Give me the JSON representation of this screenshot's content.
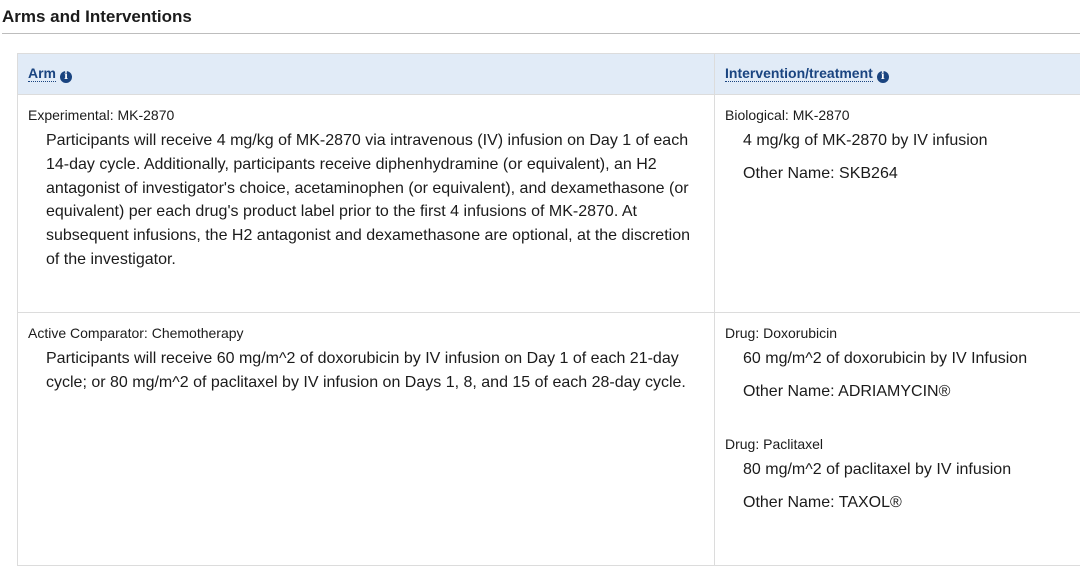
{
  "section": {
    "title": "Arms and Interventions"
  },
  "table": {
    "headers": {
      "arm": "Arm",
      "intervention": "Intervention/treatment"
    },
    "rows": [
      {
        "arm_label": "Experimental: MK-2870",
        "arm_description": "Participants will receive 4 mg/kg of MK-2870 via intravenous (IV) infusion on Day 1 of each 14-day cycle. Additionally, participants receive diphenhydramine (or equivalent), an H2 antagonist of investigator's choice, acetaminophen (or equivalent), and dexamethasone (or equivalent) per each drug's product label prior to the first 4 infusions of MK-2870. At subsequent infusions, the H2 antagonist and dexamethasone are optional, at the discretion of the investigator.",
        "interventions": [
          {
            "label": "Biological: MK-2870",
            "description": "4 mg/kg of MK-2870 by IV infusion",
            "other_name": "Other Name: SKB264"
          }
        ]
      },
      {
        "arm_label": "Active Comparator: Chemotherapy",
        "arm_description": "Participants will receive 60 mg/m^2 of doxorubicin by IV infusion on Day 1 of each 21-day cycle; or 80 mg/m^2 of paclitaxel by IV infusion on Days 1, 8, and 15 of each 28-day cycle.",
        "interventions": [
          {
            "label": "Drug: Doxorubicin",
            "description": "60 mg/m^2 of doxorubicin by IV Infusion",
            "other_name": "Other Name: ADRIAMYCIN®"
          },
          {
            "label": "Drug: Paclitaxel",
            "description": "80 mg/m^2 of paclitaxel by IV infusion",
            "other_name": "Other Name: TAXOL®"
          }
        ]
      }
    ]
  },
  "icons": {
    "info": "info-circle-icon"
  },
  "colors": {
    "header_bg": "#e1ebf7",
    "header_text": "#1a4480",
    "border": "#dcdcdc"
  }
}
